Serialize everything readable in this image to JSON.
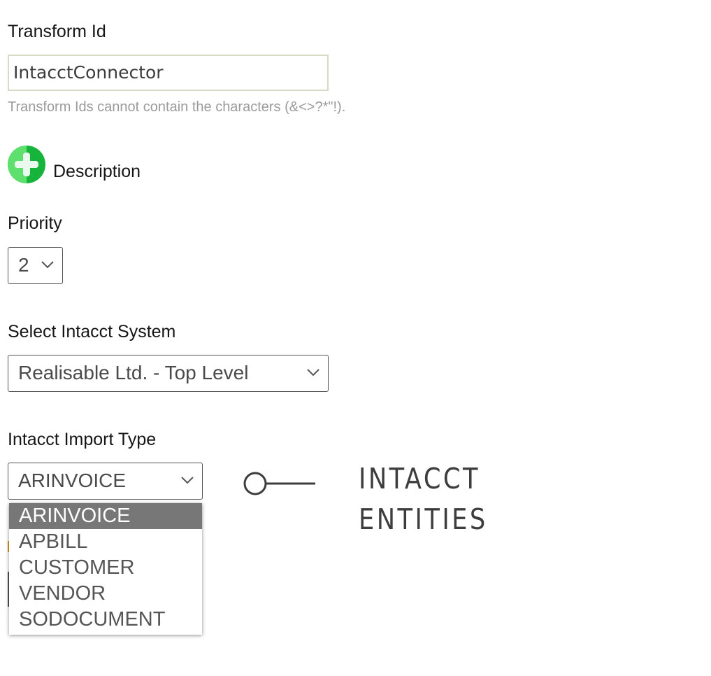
{
  "transform_id": {
    "label": "Transform Id",
    "value": "IntacctConnector",
    "hint": "Transform Ids cannot contain the characters (&<>?*\"!)."
  },
  "description": {
    "label": "Description",
    "icon": "plus-circle-icon",
    "icon_colors": {
      "light": "#5ee06f",
      "dark": "#17b43c"
    }
  },
  "priority": {
    "label": "Priority",
    "value": "2"
  },
  "intacct_system": {
    "label": "Select Intacct System",
    "value": "Realisable Ltd. - Top Level"
  },
  "import_type": {
    "label": "Intacct Import Type",
    "value": "ARINVOICE",
    "options": [
      "ARINVOICE",
      "APBILL",
      "CUSTOMER",
      "VENDOR",
      "SODOCUMENT"
    ],
    "highlight_color": "#777777"
  },
  "annotation": {
    "line1": "INTACCT",
    "line2": "ENTITIES"
  }
}
